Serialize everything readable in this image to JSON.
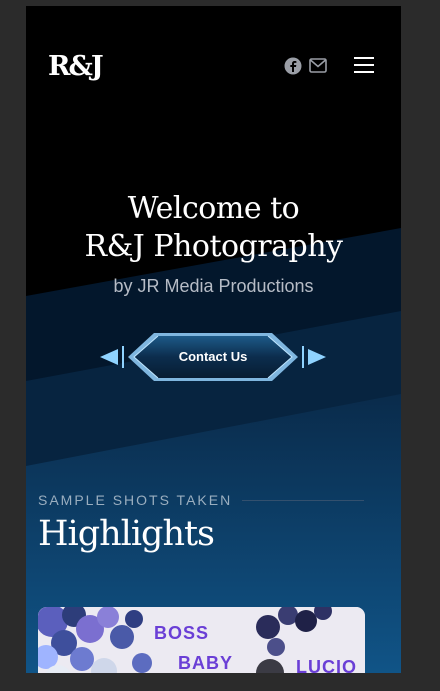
{
  "header": {
    "logo_text": "R&J",
    "icons": [
      "facebook-icon",
      "mail-icon",
      "hamburger-menu-icon"
    ]
  },
  "hero": {
    "title_line1": "Welcome to",
    "title_line2": "R&J Photography",
    "subtitle": "by JR Media Productions",
    "cta_label": "Contact Us"
  },
  "highlights": {
    "eyebrow": "SAMPLE SHOTS TAKEN",
    "title": "Highlights",
    "card_text1": "BOSS",
    "card_text2": "BABY",
    "card_text3": "LUCIO"
  },
  "colors": {
    "page_bg": "#2b2b2b",
    "hero_bg": "#000000",
    "band_dark": "#04162a",
    "band_mid": "#0b2e52",
    "band_light": "#0f4f80",
    "accent": "#8fd3ff"
  }
}
